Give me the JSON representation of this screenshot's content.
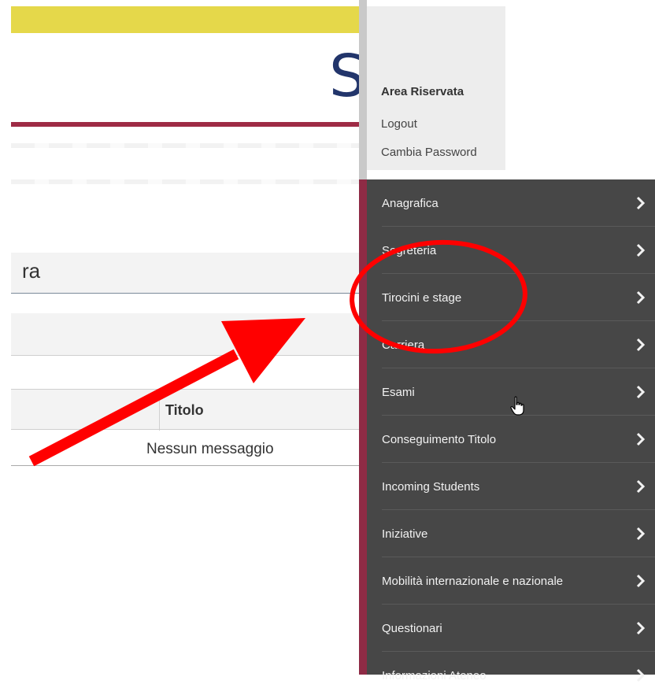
{
  "page": {
    "logo_letter": "S",
    "search_text": "ra",
    "table": {
      "columns": [
        "Titolo"
      ],
      "empty_message": "Nessun messaggio"
    }
  },
  "user_panel": {
    "title": "Area Riservata",
    "links": [
      "Logout",
      "Cambia Password"
    ]
  },
  "menu": {
    "items": [
      {
        "label": "Anagrafica",
        "icon": "chevron-right-icon"
      },
      {
        "label": "Segreteria",
        "icon": "chevron-right-icon"
      },
      {
        "label": "Tirocini e stage",
        "icon": "chevron-right-icon"
      },
      {
        "label": "Carriera",
        "icon": "chevron-right-icon"
      },
      {
        "label": "Esami",
        "icon": "chevron-right-icon"
      },
      {
        "label": "Conseguimento Titolo",
        "icon": "chevron-right-icon"
      },
      {
        "label": "Incoming Students",
        "icon": "chevron-right-icon"
      },
      {
        "label": "Iniziative",
        "icon": "chevron-right-icon"
      },
      {
        "label": "Mobilità internazionale e nazionale",
        "icon": "chevron-right-icon"
      },
      {
        "label": "Questionari",
        "icon": "chevron-right-icon"
      },
      {
        "label": "Informazioni Ateneo",
        "icon": "chevron-right-icon"
      }
    ]
  },
  "annotations": {
    "highlight_color": "#ff0000",
    "highlighted_item": "Tirocini e stage"
  },
  "colors": {
    "accent_bar": "#e5d84a",
    "brand_red": "#9e2b45",
    "menu_bg": "#474747",
    "logo_blue": "#22356b"
  }
}
